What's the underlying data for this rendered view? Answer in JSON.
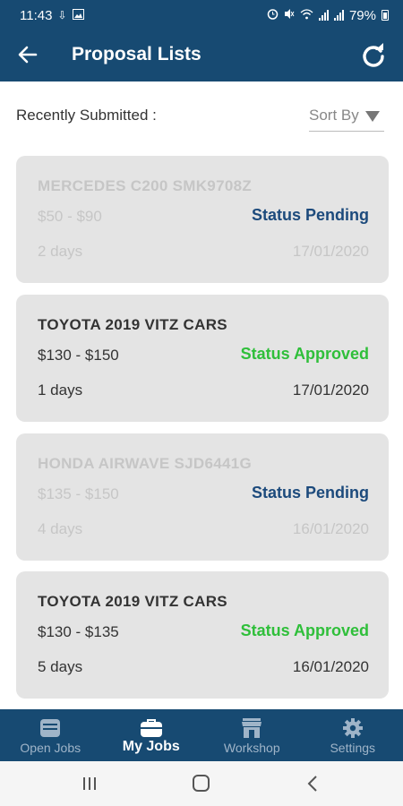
{
  "status_bar": {
    "time": "11:43",
    "battery": "79%"
  },
  "app_bar": {
    "title": "Proposal Lists"
  },
  "section": {
    "label": "Recently Submitted :",
    "sort_label": "Sort By"
  },
  "proposals": [
    {
      "title": "MERCEDES C200 SMK9708Z",
      "price": "$50 - $90",
      "status": "Status Pending",
      "age": "2 days",
      "date": "17/01/2020"
    },
    {
      "title": "TOYOTA 2019 VITZ CARS",
      "price": "$130 - $150",
      "status": "Status Approved",
      "age": "1 days",
      "date": "17/01/2020"
    },
    {
      "title": "HONDA  AIRWAVE  SJD6441G",
      "price": "$135 - $150",
      "status": "Status Pending",
      "age": "4 days",
      "date": "16/01/2020"
    },
    {
      "title": "TOYOTA 2019 VITZ CARS",
      "price": "$130 - $135",
      "status": "Status Approved",
      "age": "5 days",
      "date": "16/01/2020"
    }
  ],
  "bottom_nav": [
    {
      "label": "Open Jobs",
      "icon": "inbox-icon"
    },
    {
      "label": "My Jobs",
      "icon": "briefcase-icon",
      "selected": true
    },
    {
      "label": "Workshop",
      "icon": "store-icon"
    },
    {
      "label": "Settings",
      "icon": "gear-icon"
    }
  ],
  "colors": {
    "primary": "#174a72",
    "pending": "#1c4a7c",
    "approved": "#2fbf3a",
    "card_bg": "#e4e4e4"
  }
}
